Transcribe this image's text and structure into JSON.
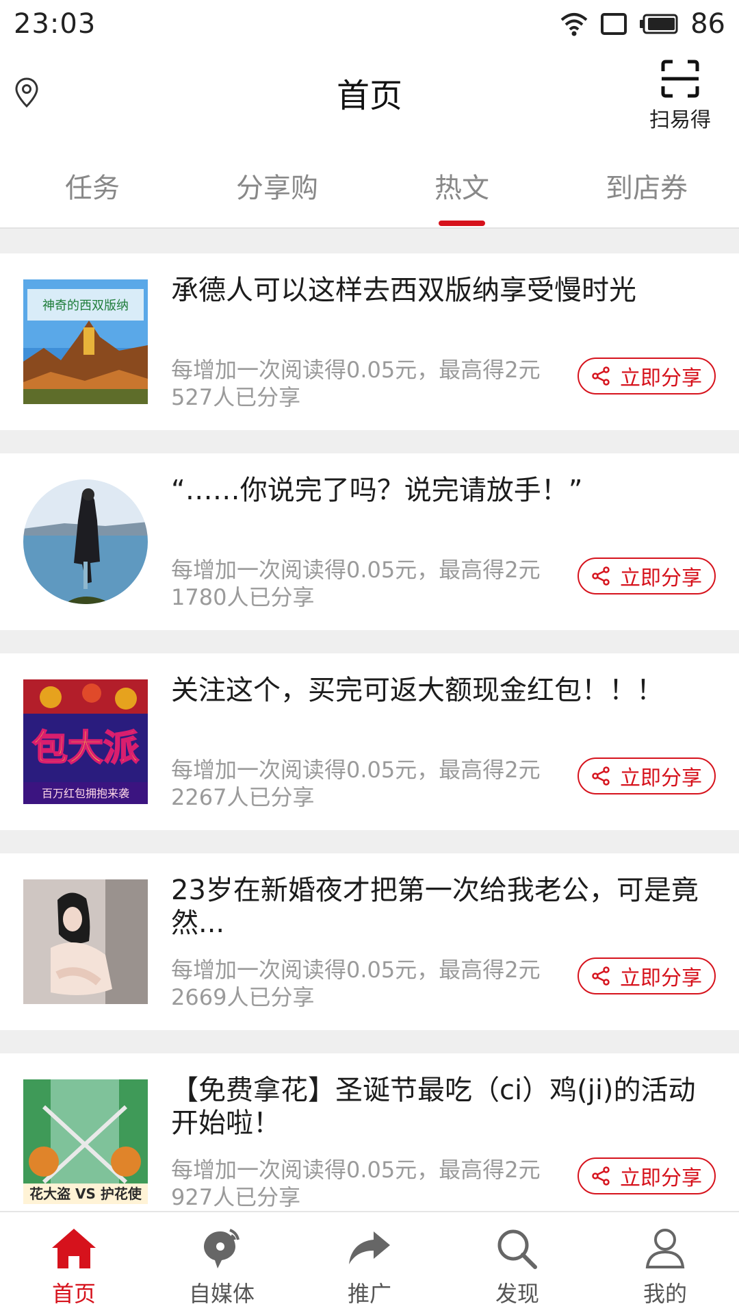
{
  "status": {
    "time": "23:03",
    "battery": "86"
  },
  "header": {
    "title": "首页",
    "scan_label": "扫易得"
  },
  "tabs": [
    {
      "label": "任务"
    },
    {
      "label": "分享购"
    },
    {
      "label": "热文",
      "active": true
    },
    {
      "label": "到店券"
    }
  ],
  "share_label": "立即分享",
  "articles": [
    {
      "title": "承德人可以这样去西双版纳享受慢时光",
      "reward": "每增加一次阅读得0.05元，最高得2元",
      "shares": "527人已分享"
    },
    {
      "title": "“……你说完了吗？说完请放手！”",
      "reward": "每增加一次阅读得0.05元，最高得2元",
      "shares": "1780人已分享"
    },
    {
      "title": "关注这个，买完可返大额现金红包！！！",
      "reward": "每增加一次阅读得0.05元，最高得2元",
      "shares": "2267人已分享"
    },
    {
      "title": "23岁在新婚夜才把第一次给我老公，可是竟然...",
      "reward": "每增加一次阅读得0.05元，最高得2元",
      "shares": "2669人已分享"
    },
    {
      "title": "【免费拿花】圣诞节最吃（ci）鸡(ji)的活动开始啦！",
      "reward": "每增加一次阅读得0.05元，最高得2元",
      "shares": "927人已分享"
    }
  ],
  "thumb_texts": {
    "a1": "神奇的西双版纳",
    "a3_big": "包大派",
    "a3_small": "百万红包拥抱来袭",
    "a5": "花大盗 VS 护花使"
  },
  "bottom_nav": [
    {
      "label": "首页",
      "icon": "home-icon",
      "active": true
    },
    {
      "label": "自媒体",
      "icon": "media-icon"
    },
    {
      "label": "推广",
      "icon": "share-arrow-icon"
    },
    {
      "label": "发现",
      "icon": "search-icon"
    },
    {
      "label": "我的",
      "icon": "user-icon"
    }
  ],
  "colors": {
    "accent": "#d6121c",
    "inactive": "#888888",
    "background": "#efefef"
  }
}
